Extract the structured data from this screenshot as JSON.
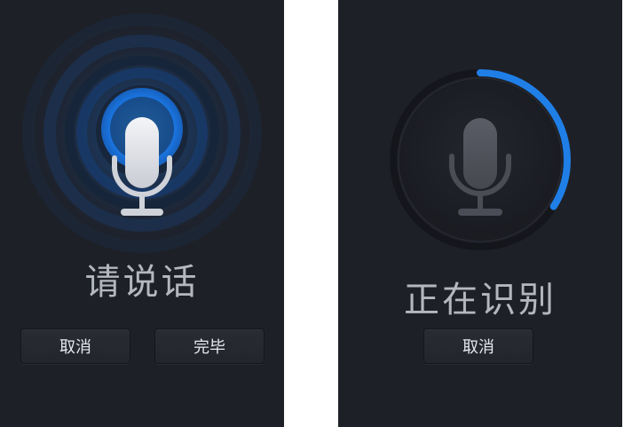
{
  "listening_screen": {
    "status": "请说话",
    "cancel_label": "取消",
    "done_label": "完毕",
    "mic_icon": "microphone-icon",
    "wave_icon": "sound-waves-icon",
    "accent_color": "#1f7fe6"
  },
  "recognizing_screen": {
    "status": "正在识别",
    "cancel_label": "取消",
    "mic_icon": "microphone-icon",
    "progress_ring_icon": "progress-ring-icon",
    "progress_fraction": 0.34,
    "accent_color": "#1f7fe6"
  }
}
